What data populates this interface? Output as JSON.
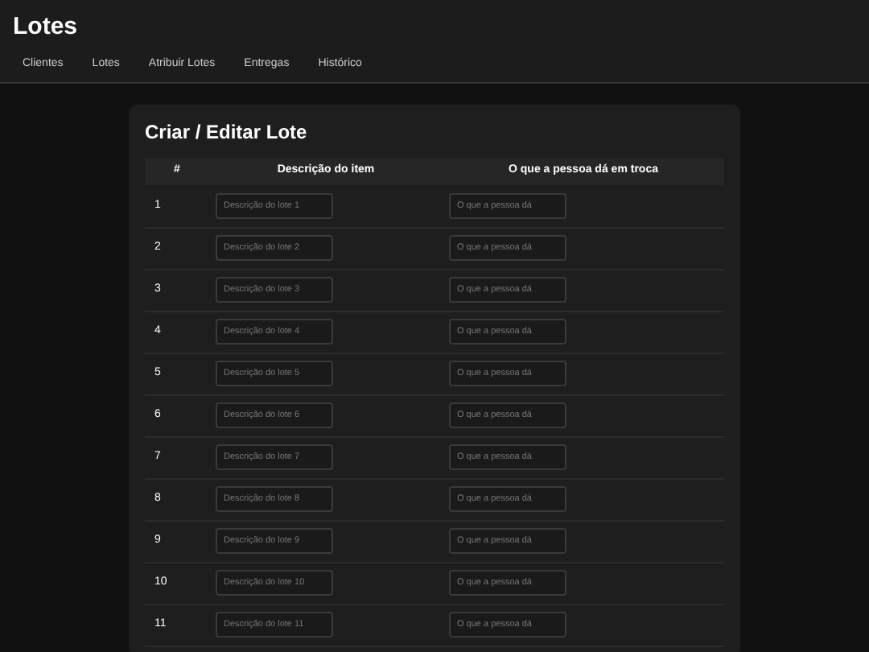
{
  "header": {
    "title": "Lotes",
    "nav": [
      {
        "label": "Clientes"
      },
      {
        "label": "Lotes"
      },
      {
        "label": "Atribuir Lotes"
      },
      {
        "label": "Entregas"
      },
      {
        "label": "Histórico"
      }
    ]
  },
  "card": {
    "title": "Criar / Editar Lote",
    "table": {
      "columns": [
        "#",
        "Descrição do item",
        "O que a pessoa dá em troca"
      ],
      "rows": [
        {
          "number": "1",
          "description_placeholder": "Descrição do lote 1",
          "trade_placeholder": "O que a pessoa dá"
        },
        {
          "number": "2",
          "description_placeholder": "Descrição do lote 2",
          "trade_placeholder": "O que a pessoa dá"
        },
        {
          "number": "3",
          "description_placeholder": "Descrição do lote 3",
          "trade_placeholder": "O que a pessoa dá"
        },
        {
          "number": "4",
          "description_placeholder": "Descrição do lote 4",
          "trade_placeholder": "O que a pessoa dá"
        },
        {
          "number": "5",
          "description_placeholder": "Descrição do lote 5",
          "trade_placeholder": "O que a pessoa dá"
        },
        {
          "number": "6",
          "description_placeholder": "Descrição do lote 6",
          "trade_placeholder": "O que a pessoa dá"
        },
        {
          "number": "7",
          "description_placeholder": "Descrição do lote 7",
          "trade_placeholder": "O que a pessoa dá"
        },
        {
          "number": "8",
          "description_placeholder": "Descrição do lote 8",
          "trade_placeholder": "O que a pessoa dá"
        },
        {
          "number": "9",
          "description_placeholder": "Descrição do lote 9",
          "trade_placeholder": "O que a pessoa dá"
        },
        {
          "number": "10",
          "description_placeholder": "Descrição do lote 10",
          "trade_placeholder": "O que a pessoa dá"
        },
        {
          "number": "11",
          "description_placeholder": "Descrição do lote 11",
          "trade_placeholder": "O que a pessoa dá"
        }
      ]
    }
  }
}
